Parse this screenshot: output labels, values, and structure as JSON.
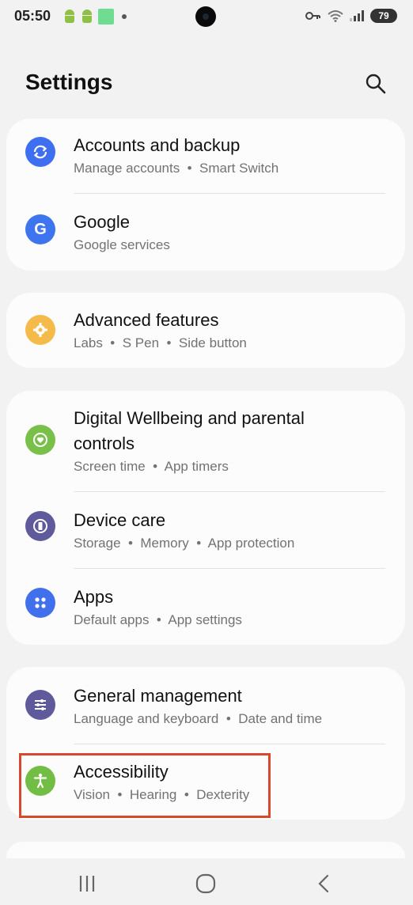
{
  "status_bar": {
    "time": "05:50",
    "battery": "79",
    "icons": [
      "android-icon",
      "android-icon",
      "green-notification-icon",
      "dot-icon",
      "key-icon",
      "wifi-icon",
      "signal-icon",
      "battery-icon"
    ]
  },
  "header": {
    "title": "Settings",
    "search_icon": "search-icon"
  },
  "groups": [
    {
      "items": [
        {
          "title": "Accounts and backup",
          "subtitle": "Manage accounts  •  Smart Switch",
          "icon": "sync-icon",
          "color": "#3e6ff0"
        },
        {
          "title": "Google",
          "subtitle": "Google services",
          "icon": "google-icon",
          "color": "#3f74ef"
        }
      ]
    },
    {
      "items": [
        {
          "title": "Advanced features",
          "subtitle": "Labs  •  S Pen  •  Side button",
          "icon": "gear-plus-icon",
          "color": "#f4bb4a"
        }
      ]
    },
    {
      "items": [
        {
          "title": "Digital Wellbeing and parental",
          "title_line2": "controls",
          "subtitle": "Screen time  •  App timers",
          "icon": "heart-circle-icon",
          "color": "#79c04b"
        },
        {
          "title": "Device care",
          "subtitle": "Storage  •  Memory  •  App protection",
          "icon": "device-care-icon",
          "color": "#5f5a9c"
        },
        {
          "title": "Apps",
          "subtitle": "Default apps  •  App settings",
          "icon": "apps-icon",
          "color": "#4170ed"
        }
      ]
    },
    {
      "items": [
        {
          "title": "General management",
          "subtitle": "Language and keyboard  •  Date and time",
          "icon": "sliders-icon",
          "color": "#5f5a9c"
        },
        {
          "title": "Accessibility",
          "subtitle": "Vision  •  Hearing  •  Dexterity",
          "icon": "accessibility-icon",
          "color": "#72bd43"
        }
      ]
    }
  ],
  "highlight_color": "#d9472f",
  "nav_bar": {
    "icons": [
      "recents-icon",
      "home-icon",
      "back-icon"
    ]
  }
}
